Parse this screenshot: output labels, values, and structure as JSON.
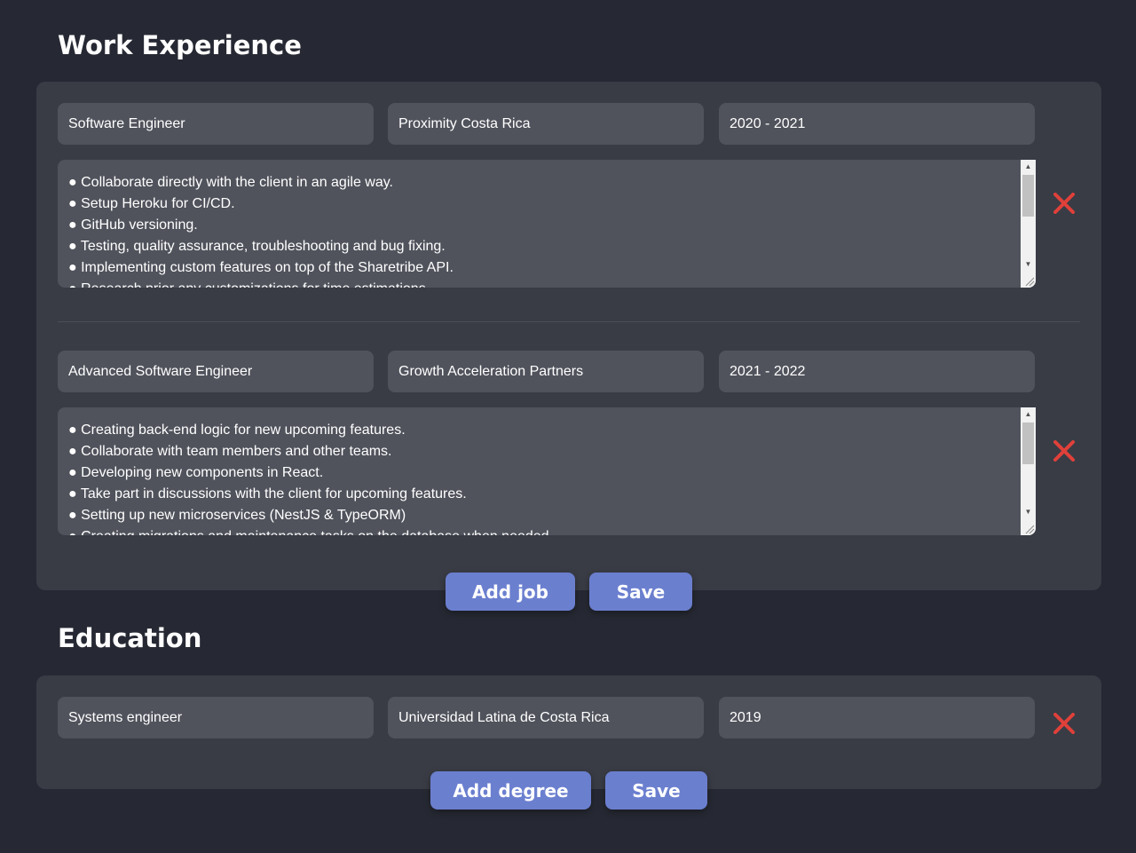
{
  "work": {
    "title": "Work Experience",
    "jobs": [
      {
        "position": "Software Engineer",
        "company": "Proximity Costa Rica",
        "period": "2020 - 2021",
        "description": [
          "● Collaborate directly with the client in an agile way.",
          "● Setup Heroku for CI/CD.",
          "● GitHub versioning.",
          "● Testing, quality assurance, troubleshooting and bug fixing.",
          "● Implementing custom features on top of the Sharetribe API.",
          "● Research prior any customizations for time estimations."
        ]
      },
      {
        "position": "Advanced Software Engineer",
        "company": "Growth Acceleration Partners",
        "period": "2021 - 2022",
        "description": [
          "● Creating back-end logic for new upcoming features.",
          "● Collaborate with team members and other teams.",
          "● Developing new components in React.",
          "● Take part in discussions with the client for upcoming features.",
          "● Setting up new microservices (NestJS & TypeORM)",
          "● Creating migrations and maintenance tasks on the database when needed."
        ]
      }
    ],
    "add_label": "Add job",
    "save_label": "Save"
  },
  "education": {
    "title": "Education",
    "degrees": [
      {
        "degree": "Systems engineer",
        "school": "Universidad Latina de Costa Rica",
        "year": "2019"
      }
    ],
    "add_label": "Add degree",
    "save_label": "Save"
  },
  "colors": {
    "background": "#262933",
    "panel": "#393c45",
    "field": "#50535c",
    "button": "#6b7fcf",
    "delete": "#e0403a"
  },
  "icons": {
    "delete": "close-icon",
    "scroll_up": "triangle-up",
    "scroll_down": "triangle-down",
    "resize": "resize-grip"
  }
}
